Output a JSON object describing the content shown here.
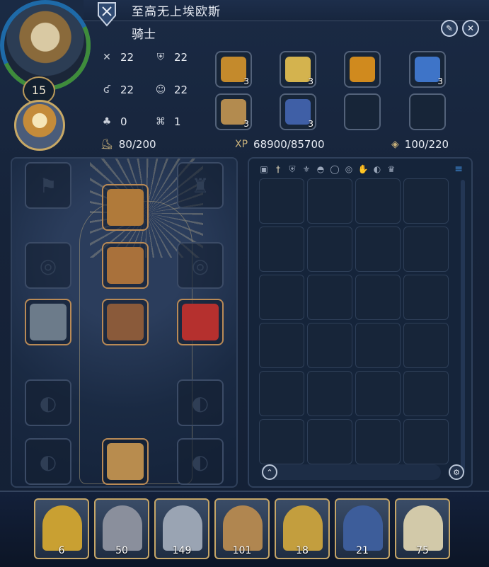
{
  "character": {
    "name": "至高无上埃欧斯",
    "class": "骑士",
    "level": "15",
    "stats": [
      {
        "icon": "crossed-swords-icon",
        "value": "22"
      },
      {
        "icon": "shield-icon",
        "value": "22"
      },
      {
        "icon": "power-icon",
        "value": "22"
      },
      {
        "icon": "head-icon",
        "value": "22"
      },
      {
        "icon": "clover-icon",
        "value": "0"
      },
      {
        "icon": "wings-icon",
        "value": "1"
      }
    ],
    "movement": "80/200",
    "xp_label": "XP",
    "xp": "68900/85700",
    "mana": "100/220"
  },
  "buffs": [
    {
      "name": "praying-hands-buff",
      "count": "3",
      "color": "#c48a2c"
    },
    {
      "name": "glowing-sword-buff",
      "count": "3",
      "color": "#d4b34e"
    },
    {
      "name": "golden-armor-buff",
      "count": "",
      "color": "#d08a1e"
    },
    {
      "name": "wizard-hat-buff",
      "count": "3",
      "color": "#3e74c8"
    },
    {
      "name": "scroll-buff",
      "count": "3",
      "color": "#b38b4f"
    },
    {
      "name": "crossed-banner-buff",
      "count": "3",
      "color": "#3f5fa6"
    }
  ],
  "equipment": {
    "helmet": {
      "color": "#b07a3a"
    },
    "chest": {
      "color": "#a9713b"
    },
    "ring": {
      "color": "#8a5a3a"
    },
    "sword": {
      "color": "#6c7b8a"
    },
    "shield": {
      "color": "#b5302e"
    },
    "boots": {
      "color": "#b88c4e"
    }
  },
  "inventory": {
    "filter_icons": [
      "hammer",
      "dagger",
      "shield",
      "armor",
      "helmet",
      "ring",
      "bracer",
      "glove",
      "bag",
      "crown"
    ]
  },
  "heroes": [
    {
      "name": "hero-1",
      "count": "6",
      "color": "#c9a032"
    },
    {
      "name": "hero-2",
      "count": "50",
      "color": "#8a8f9c"
    },
    {
      "name": "hero-3",
      "count": "149",
      "color": "#9aa4b3"
    },
    {
      "name": "hero-4",
      "count": "101",
      "color": "#b08650"
    },
    {
      "name": "hero-5",
      "count": "18",
      "color": "#c39e3e"
    },
    {
      "name": "hero-6",
      "count": "21",
      "color": "#3d5d9a"
    },
    {
      "name": "hero-7",
      "count": "75",
      "color": "#d2c9a9"
    }
  ]
}
